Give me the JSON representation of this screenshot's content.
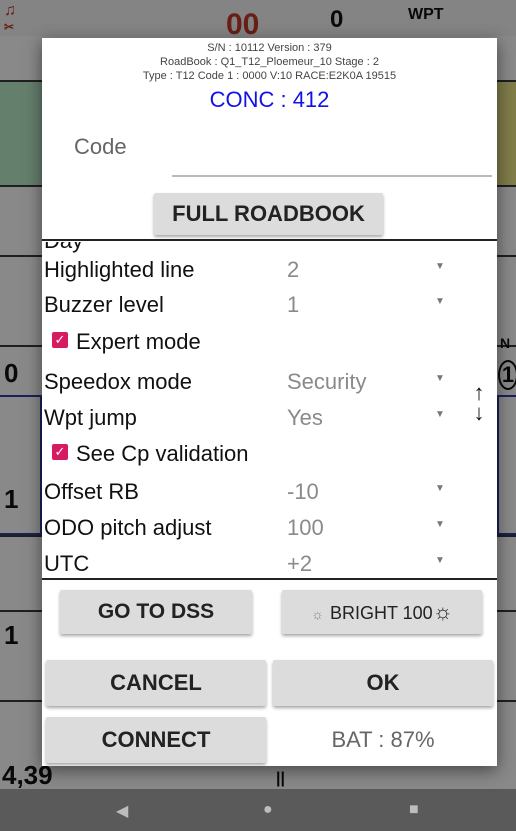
{
  "background": {
    "top_value": "0",
    "top_label": "WPT",
    "counter": "00",
    "left_numbers": [
      "0",
      "1",
      "1"
    ],
    "bottom_value": "4,39",
    "right_letter": "N",
    "right_circle": "1",
    "separator": "||"
  },
  "dialog": {
    "info_line1": "S/N : 10112 Version : 379",
    "info_line2": "RoadBook : Q1_T12_Ploemeur_10 Stage : 2",
    "info_line3": "Type : T12 Code 1 : 0000 V:10 RACE:E2K0A 19515",
    "conc": "CONC : 412",
    "code_label": "Code",
    "full_roadbook": "FULL ROADBOOK",
    "settings": [
      {
        "label": "Highlighted line",
        "value": "2"
      },
      {
        "label": "Buzzer level",
        "value": "1"
      },
      {
        "label": "Expert mode",
        "checked": true
      },
      {
        "label": "Speedox mode",
        "value": "Security"
      },
      {
        "label": "Wpt jump",
        "value": "Yes"
      },
      {
        "label": "See Cp validation",
        "checked": true
      },
      {
        "label": "Offset RB",
        "value": "-10"
      },
      {
        "label": "ODO pitch adjust",
        "value": "100"
      },
      {
        "label": "UTC",
        "value": "+2"
      }
    ],
    "go_to_dss": "GO TO DSS",
    "bright": "BRIGHT 100",
    "cancel": "CANCEL",
    "ok": "OK",
    "connect": "CONNECT",
    "bat": "BAT : 87%"
  },
  "icons": {
    "caret": "caret-down-icon",
    "checkbox": "checkbox-checked-icon",
    "drag": "vertical-drag-icon",
    "sun_small": "sun-small-icon",
    "sun_large": "sun-large-icon",
    "bell": "bell-icon",
    "tools": "tools-icon",
    "back": "back-nav-icon",
    "home": "home-nav-icon",
    "recents": "recents-nav-icon"
  },
  "colors": {
    "accent_blue": "#1212e6",
    "checkbox_pink": "#d81b60",
    "button_gray": "#dcdcdc",
    "dialog_bg": "#ffffff",
    "value_gray": "#8a8a8a"
  }
}
